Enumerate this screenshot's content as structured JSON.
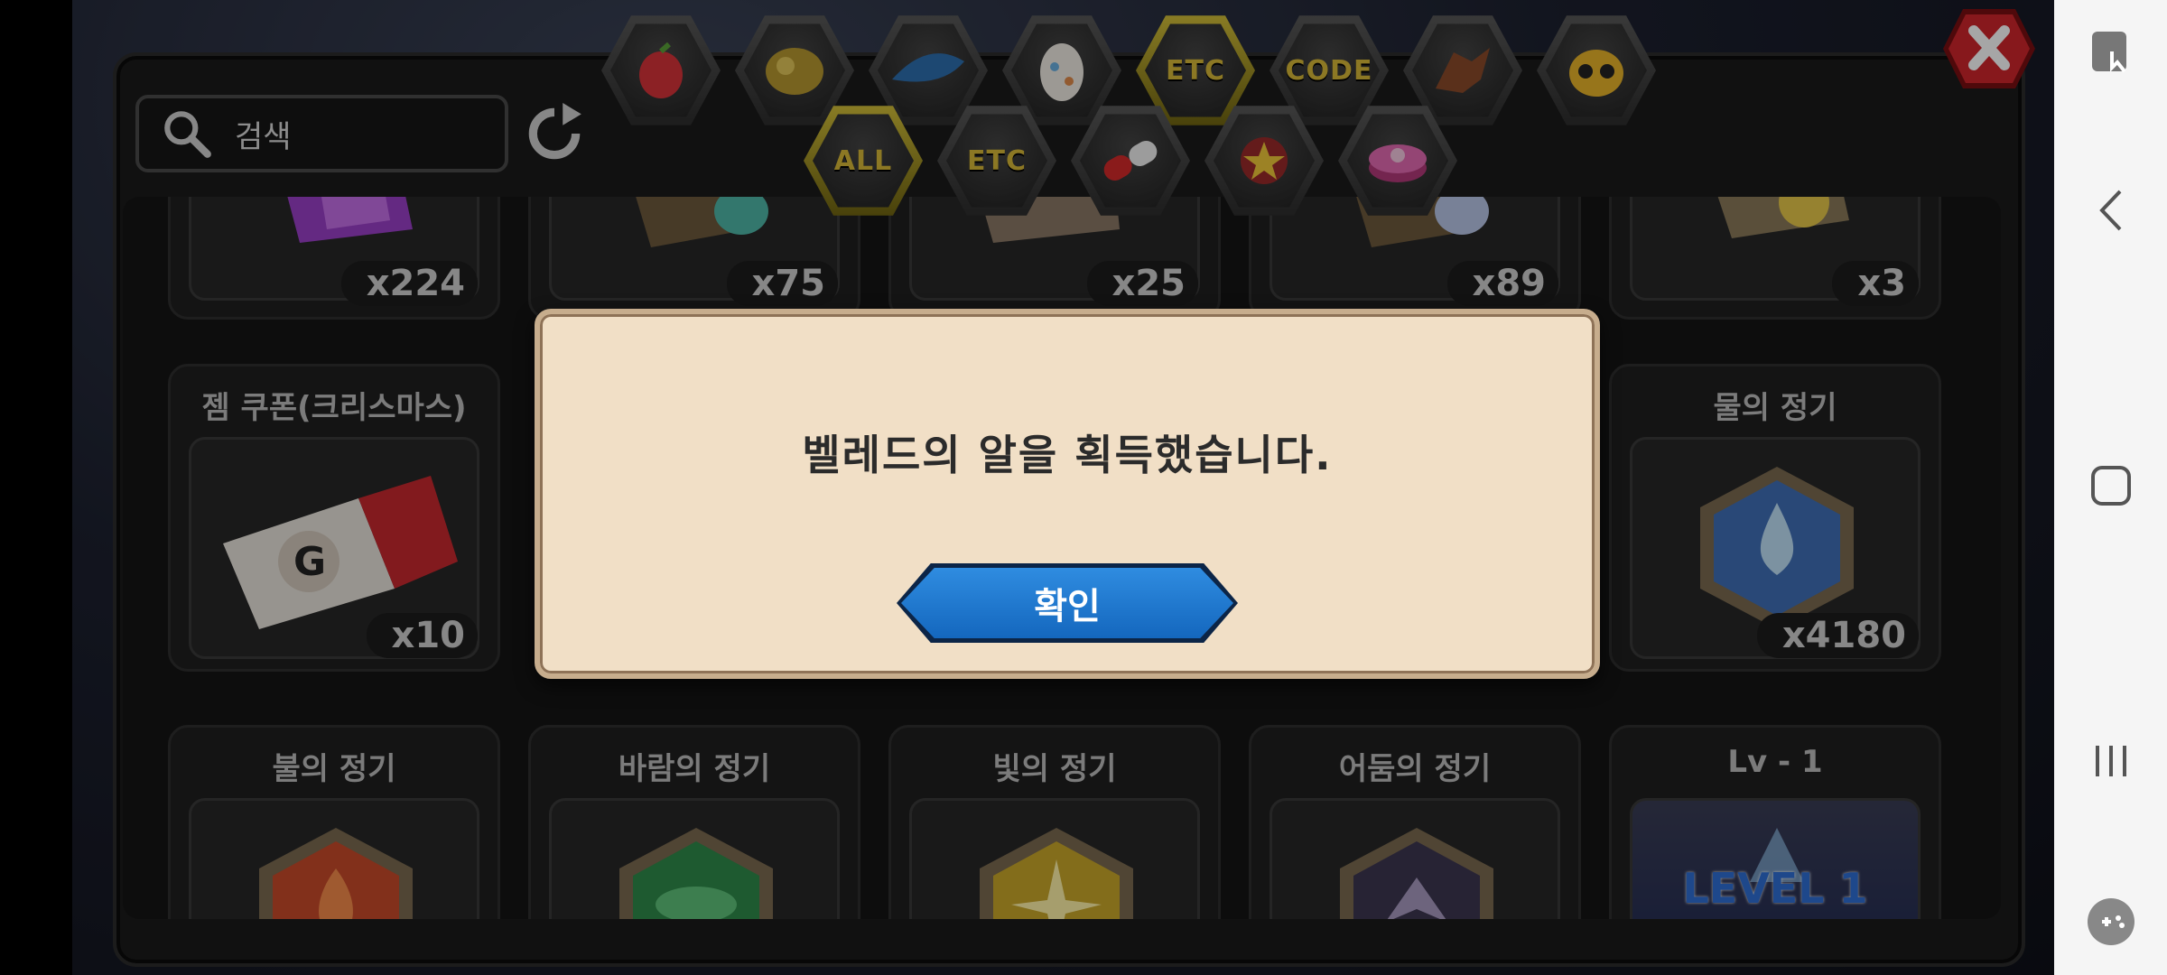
{
  "search": {
    "placeholder": "검색"
  },
  "category_tabs_top": [
    {
      "icon": "fruit-icon"
    },
    {
      "icon": "gold-ore-icon"
    },
    {
      "icon": "blue-wing-icon"
    },
    {
      "icon": "egg-icon"
    },
    {
      "label": "ETC",
      "active": true
    },
    {
      "label": "CODE"
    },
    {
      "icon": "dragon-icon"
    },
    {
      "icon": "owl-mask-icon"
    }
  ],
  "category_tabs_bottom": [
    {
      "label": "ALL",
      "active": true
    },
    {
      "label": "ETC"
    },
    {
      "icon": "pill-icon"
    },
    {
      "icon": "star-emblem-icon"
    },
    {
      "icon": "gift-box-icon"
    }
  ],
  "items_row1": [
    {
      "count": "x224",
      "icon": "purple-crystal-icon"
    },
    {
      "count": "x75",
      "icon": "scroll-teal-icon"
    },
    {
      "count": "x25",
      "icon": "paper-icon"
    },
    {
      "count": "x89",
      "icon": "scroll-blue-icon"
    },
    {
      "count": "x3",
      "icon": "scroll-gold-icon"
    }
  ],
  "items_row2": [
    {
      "name": "젬 쿠폰(크리스마스)",
      "count": "x10",
      "icon": "coupon-icon"
    },
    {
      "name": "물의 정기",
      "count": "x4180",
      "icon": "water-essence-icon"
    }
  ],
  "items_row3": [
    {
      "name": "불의 정기",
      "icon": "fire-essence-icon"
    },
    {
      "name": "바람의 정기",
      "icon": "wind-essence-icon"
    },
    {
      "name": "빛의 정기",
      "icon": "light-essence-icon"
    },
    {
      "name": "어둠의 정기",
      "icon": "dark-essence-icon"
    },
    {
      "name": "Lv - 1",
      "icon": "level-1-badge-icon",
      "badge_text": "LEVEL 1"
    }
  ],
  "dialog": {
    "message": "벨레드의 알을 획득했습니다.",
    "confirm_label": "확인"
  },
  "colors": {
    "accent": "#d6c23a",
    "dialog_bg": "#f1dfc6",
    "button_blue": "#1f7ad1"
  }
}
